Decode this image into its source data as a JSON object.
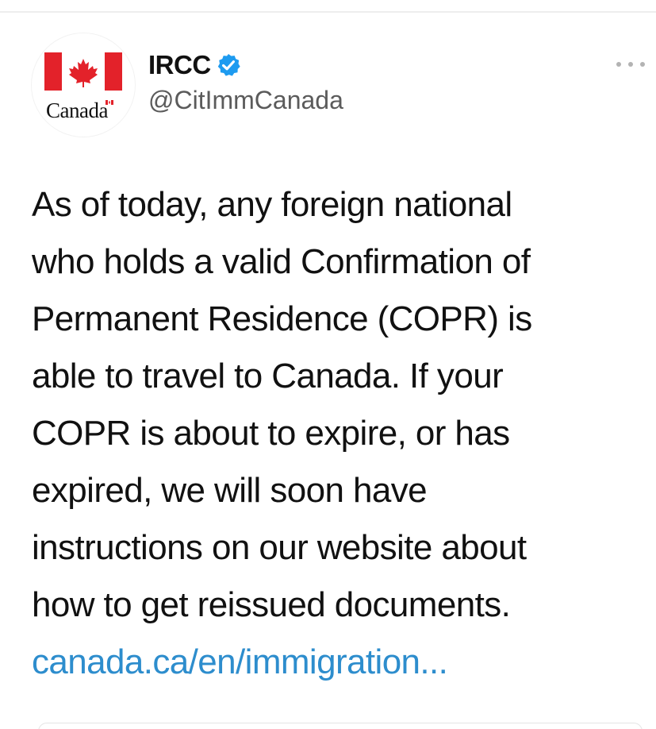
{
  "account": {
    "display_name": "IRCC",
    "handle": "@CitImmCanada",
    "verified": true,
    "avatar_wordmark": "Canada"
  },
  "tweet": {
    "lines": [
      "As of today, any foreign national",
      "who holds a valid Confirmation of",
      "Permanent Residence (COPR) is",
      "able to travel to Canada. If your",
      "COPR is about to expire, or has",
      "expired, we will soon have",
      "instructions on our website about",
      "how to get reissued documents."
    ],
    "link_text": "canada.ca/en/immigration..."
  },
  "icons": {
    "verified": "verified-badge-icon",
    "more": "more-options-icon",
    "flag": "canada-flag-icon"
  },
  "colors": {
    "canada_red": "#e3222a",
    "verified_blue": "#1d9bf0",
    "link_blue": "#2d8dcd",
    "handle_gray": "#5b5b5b"
  }
}
